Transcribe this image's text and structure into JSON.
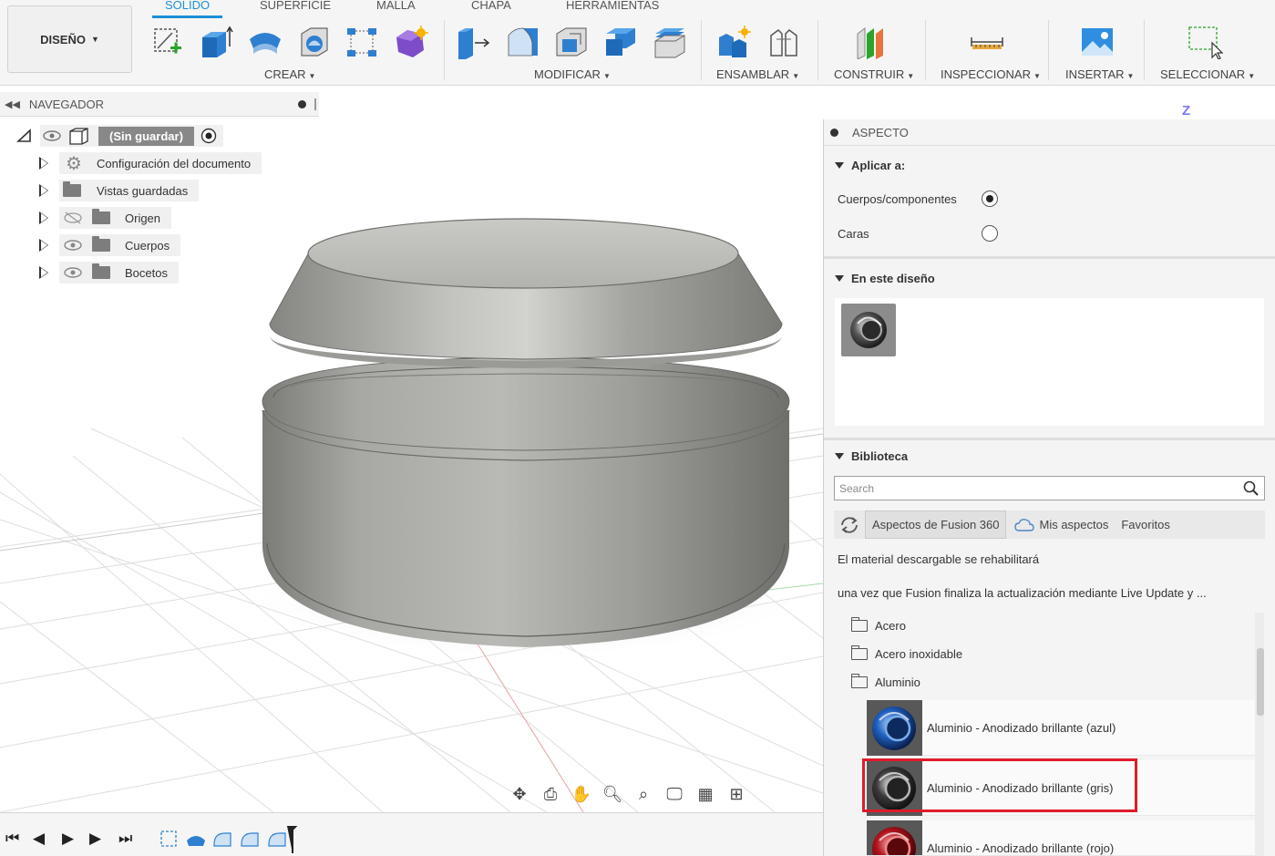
{
  "ribbon": {
    "workspace_button": "DISEÑO",
    "tabs": [
      "SOLIDO",
      "SUPERFICIE",
      "MALLA",
      "CHAPA",
      "HERRAMIENTAS"
    ],
    "active_tab": "SOLIDO",
    "groups": {
      "crear": "CREAR",
      "modificar": "MODIFICAR",
      "ensamblar": "ENSAMBLAR",
      "construir": "CONSTRUIR",
      "inspeccionar": "INSPECCIONAR",
      "insertar": "INSERTAR",
      "seleccionar": "SELECCIONAR"
    },
    "accent_color": "#1c8fd6"
  },
  "navigator": {
    "title": "NAVEGADOR",
    "root": "(Sin guardar)",
    "items": [
      {
        "label": "Configuración del documento",
        "icon": "gear-icon"
      },
      {
        "label": "Vistas guardadas",
        "icon": "folder-icon"
      },
      {
        "label": "Origen",
        "icon": "folder-icon",
        "visibility": "hidden"
      },
      {
        "label": "Cuerpos",
        "icon": "folder-icon",
        "visibility": "visible"
      },
      {
        "label": "Bocetos",
        "icon": "folder-icon",
        "visibility": "visible"
      }
    ]
  },
  "viewcube": {
    "axis_label": "Z"
  },
  "appearance_panel": {
    "title": "ASPECTO",
    "apply_to": {
      "title": "Aplicar a:",
      "options": [
        {
          "label": "Cuerpos/componentes",
          "selected": true
        },
        {
          "label": "Caras",
          "selected": false
        }
      ]
    },
    "in_design": {
      "title": "En este diseño",
      "swatches": [
        "gray-anodized-swatch"
      ]
    },
    "library": {
      "title": "Biblioteca",
      "search_placeholder": "Search",
      "tabs": [
        "Aspectos de Fusion 360",
        "Mis aspectos",
        "Favoritos"
      ],
      "active_tab": "Aspectos de Fusion 360",
      "message_line1": "El material descargable se rehabilitará",
      "message_line2": "una vez que Fusion finaliza la actualización mediante Live Update y ...",
      "folders": [
        "Acero",
        "Acero inoxidable",
        "Aluminio"
      ],
      "materials": [
        {
          "name": "Aluminio - Anodizado brillante (azul)",
          "color": "#1f5fbf"
        },
        {
          "name": "Aluminio - Anodizado brillante (gris)",
          "color": "#3a3a3a",
          "highlighted": true
        },
        {
          "name": "Aluminio - Anodizado brillante (rojo)",
          "color": "#b0141c"
        }
      ],
      "highlight_color": "#e01b2a"
    }
  }
}
